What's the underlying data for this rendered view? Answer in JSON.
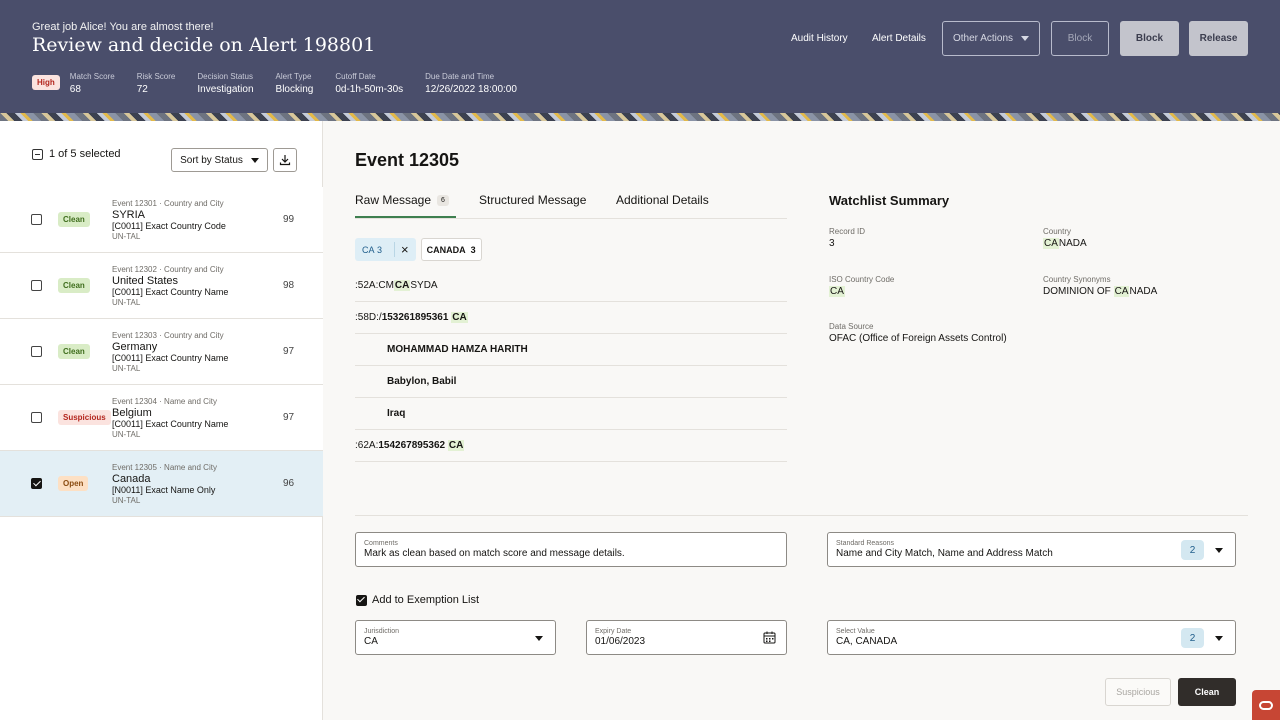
{
  "header": {
    "greeting": "Great job Alice! You are almost there!",
    "title": "Review and decide on Alert 198801",
    "priority": "High",
    "meta": [
      {
        "label": "Match Score",
        "value": "68"
      },
      {
        "label": "Risk Score",
        "value": "72"
      },
      {
        "label": "Decision Status",
        "value": "Investigation"
      },
      {
        "label": "Alert Type",
        "value": "Blocking"
      },
      {
        "label": "Cutoff Date",
        "value": "0d-1h-50m-30s"
      },
      {
        "label": "Due Date and Time",
        "value": "12/26/2022 18:00:00"
      }
    ],
    "audit_history": "Audit History",
    "alert_details": "Alert Details",
    "other_actions": "Other Actions",
    "block_outline": "Block",
    "block": "Block",
    "release": "Release"
  },
  "left": {
    "selection": "1 of 5 selected",
    "sort_label": "Sort by Status",
    "download_icon": "download-icon",
    "events": [
      {
        "meta": "Event 12301 · Country and City",
        "name": "SYRIA",
        "rule": "[C0011] Exact Country Code",
        "source": "UN-TAL",
        "status": "Clean",
        "score": "99",
        "checked": false
      },
      {
        "meta": "Event 12302 · Country and City",
        "name": "United States",
        "rule": "[C0011] Exact Country Name",
        "source": "UN-TAL",
        "status": "Clean",
        "score": "98",
        "checked": false
      },
      {
        "meta": "Event 12303 · Country and City",
        "name": "Germany",
        "rule": "[C0011] Exact Country Name",
        "source": "UN-TAL",
        "status": "Clean",
        "score": "97",
        "checked": false
      },
      {
        "meta": "Event 12304 · Name and City",
        "name": "Belgium",
        "rule": "[C0011] Exact Country Name",
        "source": "UN-TAL",
        "status": "Suspicious",
        "score": "97",
        "checked": false
      },
      {
        "meta": "Event 12305 · Name and City",
        "name": "Canada",
        "rule": "[N0011] Exact Name Only",
        "source": "UN-TAL",
        "status": "Open",
        "score": "96",
        "checked": true
      }
    ]
  },
  "main": {
    "event_title": "Event 12305",
    "tabs": [
      {
        "label": "Raw Message",
        "badge": "6"
      },
      {
        "label": "Structured Message"
      },
      {
        "label": "Additional Details"
      }
    ],
    "chips": {
      "chip1_label": "CA",
      "chip1_count": "3",
      "chip2_label": "CANADA",
      "chip2_count": "3"
    },
    "lines": {
      "l1_pre": ":52A:CM",
      "l1_hl": "CA",
      "l1_post": "SYDA",
      "l2_pre": ":58D:/",
      "l2_bold": "153261895361",
      "l2_hl": "CA",
      "l3": "MOHAMMAD HAMZA HARITH",
      "l4": "Babylon, Babil",
      "l5": "Iraq",
      "l6_pre": ":62A:",
      "l6_bold": "154267895362",
      "l6_hl": "CA"
    }
  },
  "watchlist": {
    "title": "Watchlist Summary",
    "record_id_label": "Record ID",
    "record_id": "3",
    "country_label": "Country",
    "country_hl": "CA",
    "country_rest": "NADA",
    "iso_label": "ISO Country Code",
    "iso": "CA",
    "synonyms_label": "Country Synonyms",
    "syn_pre": "DOMINION OF ",
    "syn_hl": "CA",
    "syn_post": "NADA",
    "source_label": "Data Source",
    "source": "OFAC (Office of Foreign Assets Control)"
  },
  "form": {
    "comments_label": "Comments",
    "comments_value": "Mark as clean based on match score and message details.",
    "reasons_label": "Standard Reasons",
    "reasons_value": "Name and City Match, Name and Address Match",
    "reasons_count": "2",
    "exemption_label": "Add to Exemption List",
    "jurisdiction_label": "Jurisdiction",
    "jurisdiction_value": "CA",
    "expiry_label": "Expiry Date",
    "expiry_value": "01/06/2023",
    "select_label": "Select Value",
    "select_value": "CA, CANADA",
    "select_count": "2",
    "suspicious_btn": "Suspicious",
    "clean_btn": "Clean"
  }
}
